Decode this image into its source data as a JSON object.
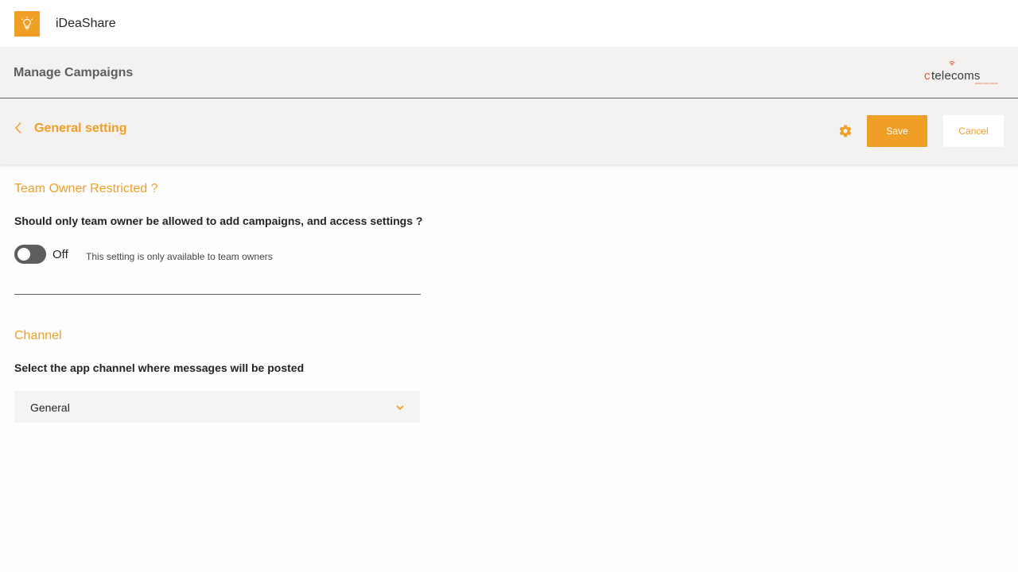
{
  "app": {
    "name": "iDeaShare",
    "logo_icon": "lightbulb-icon",
    "accent_color": "#f09f26"
  },
  "header": {
    "title": "Manage Campaigns",
    "brand_logo": "ctelecoms-logo"
  },
  "subheader": {
    "title": "General setting",
    "back_icon": "chevron-left-icon",
    "settings_icon": "gear-icon",
    "save_label": "Save",
    "cancel_label": "Cancel"
  },
  "team_owner_section": {
    "title": "Team Owner Restricted ?",
    "description": "Should only team owner be allowed to add campaigns, and access settings ?",
    "toggle_state": "Off",
    "note": "This setting is only available to team owners"
  },
  "channel_section": {
    "title": "Channel",
    "description": "Select the app channel where messages will be posted",
    "selected_value": "General",
    "dropdown_icon": "chevron-down-icon"
  }
}
